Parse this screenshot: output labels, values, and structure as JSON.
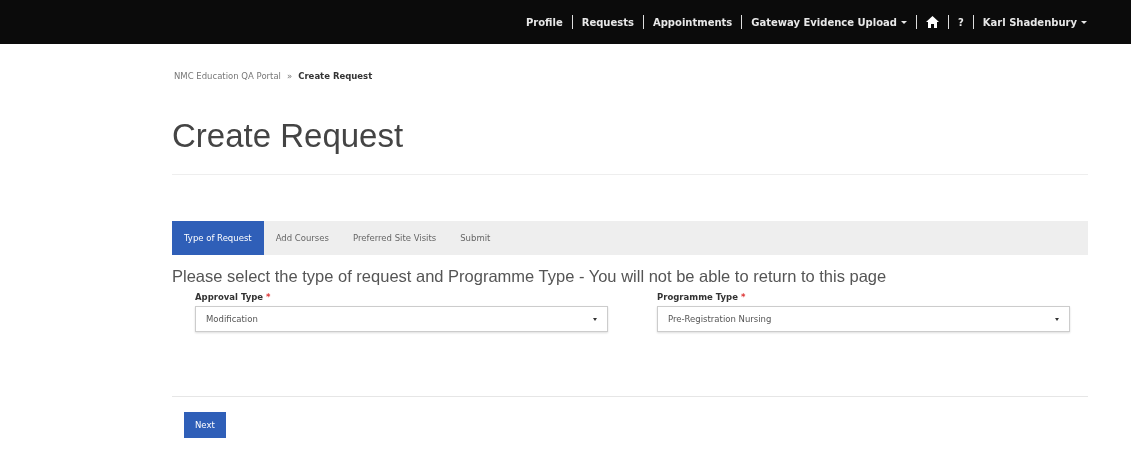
{
  "navbar": {
    "items": [
      {
        "kind": "link",
        "label": "Profile"
      },
      {
        "kind": "link",
        "label": "Requests"
      },
      {
        "kind": "link",
        "label": "Appointments"
      },
      {
        "kind": "dropdown",
        "label": "Gateway Evidence Upload"
      },
      {
        "kind": "home"
      },
      {
        "kind": "link",
        "label": "?"
      },
      {
        "kind": "dropdown",
        "label": "Karl Shadenbury"
      }
    ]
  },
  "breadcrumb": [
    {
      "label": "NMC Education QA Portal",
      "current": false
    },
    {
      "label": "Create Request",
      "current": true
    }
  ],
  "breadcrumb_separator": "»",
  "page_title": "Create Request",
  "tabs": [
    {
      "label": "Type of Request",
      "selected": true
    },
    {
      "label": "Add Courses",
      "selected": false
    },
    {
      "label": "Preferred Site Visits",
      "selected": false
    },
    {
      "label": "Submit",
      "selected": false
    }
  ],
  "instruction": "Please select the type of request and Programme Type - You will not be able to return to this page",
  "fields": [
    {
      "label": "Approval Type",
      "required": true,
      "value": "Modification"
    },
    {
      "label": "Programme Type",
      "required": true,
      "value": "Pre-Registration Nursing"
    }
  ],
  "required_mark": "*",
  "next_button": "Next"
}
